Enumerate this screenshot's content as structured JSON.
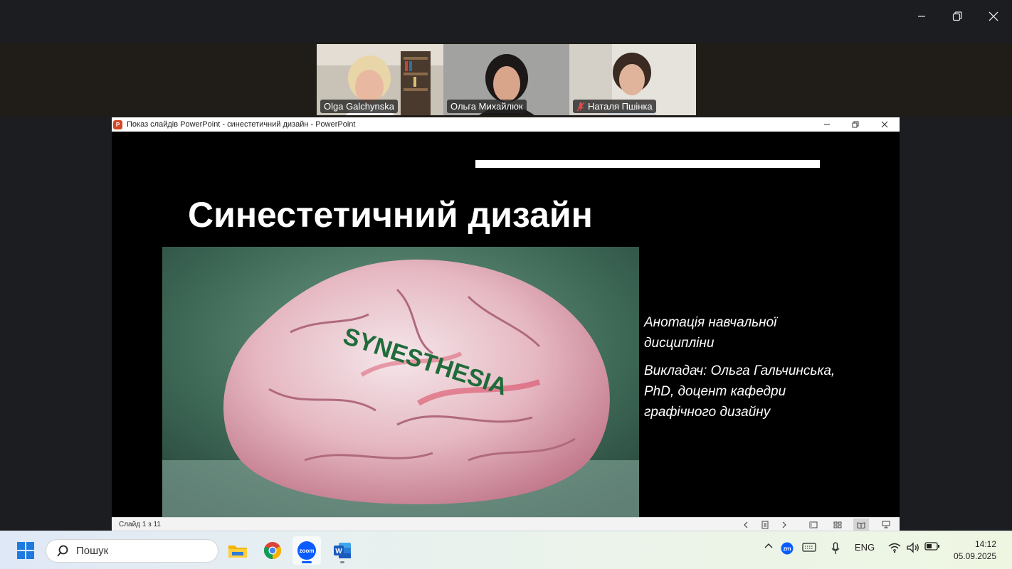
{
  "zoom": {
    "participants": [
      {
        "name": "Olga Galchynska",
        "muted": false
      },
      {
        "name": "Ольга Михайлюк",
        "muted": false
      },
      {
        "name": "Наталя Пшінка",
        "muted": true
      }
    ]
  },
  "ppt": {
    "window_title": "Показ слайдів PowerPoint  -  синестетичний дизайн - PowerPoint",
    "slide": {
      "title": "Синестетичний дизайн",
      "image_word": "SYNESTHESIA",
      "annotation": "Анотація навчальної дисципліни",
      "lecturer": "Викладач: Ольга Гальчинська, PhD, доцент кафедри графічного дизайну"
    },
    "status": {
      "counter": "Слайд 1 з 11"
    }
  },
  "taskbar": {
    "search_placeholder": "Пошук",
    "tray": {
      "language": "ENG",
      "zoom_label": "zm"
    },
    "clock": {
      "time": "14:12",
      "date": "05.09.2025"
    },
    "app_labels": {
      "zoom": "zoom"
    }
  },
  "colors": {
    "zoom_background": "#1b1d20",
    "slide_background": "#000000",
    "accent_powerpoint": "#d24726",
    "zoom_blue": "#0b5cff",
    "word_blue": "#185abd"
  }
}
